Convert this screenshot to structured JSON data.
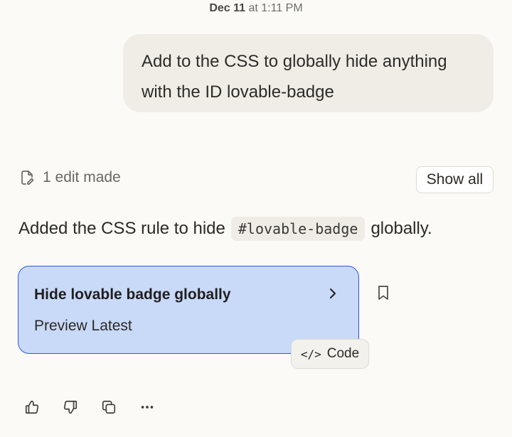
{
  "timestamp": {
    "date": "Dec 11",
    "rest": " at 1:11 PM"
  },
  "user_message": {
    "text": "Add to the CSS to globally hide anything with the ID lovable-badge"
  },
  "edit_summary": {
    "icon": "file-edit-icon",
    "label": "1 edit made",
    "show_all_label": "Show all"
  },
  "response": {
    "before_code": "Added the CSS rule to hide",
    "code": "#lovable-badge",
    "after_code": "globally."
  },
  "version_card": {
    "title": "Hide lovable badge globally",
    "subtitle": "Preview Latest",
    "accent_bg": "#c9d9f8",
    "accent_border": "#2f5bd6"
  },
  "code_button": {
    "label": "Code",
    "icon": "code-icon"
  },
  "actions": {
    "icons": [
      "thumbs-up-icon",
      "thumbs-down-icon",
      "copy-icon",
      "more-icon"
    ]
  },
  "colors": {
    "background": "#fbfaf7",
    "user_bubble": "#f0ede7"
  }
}
